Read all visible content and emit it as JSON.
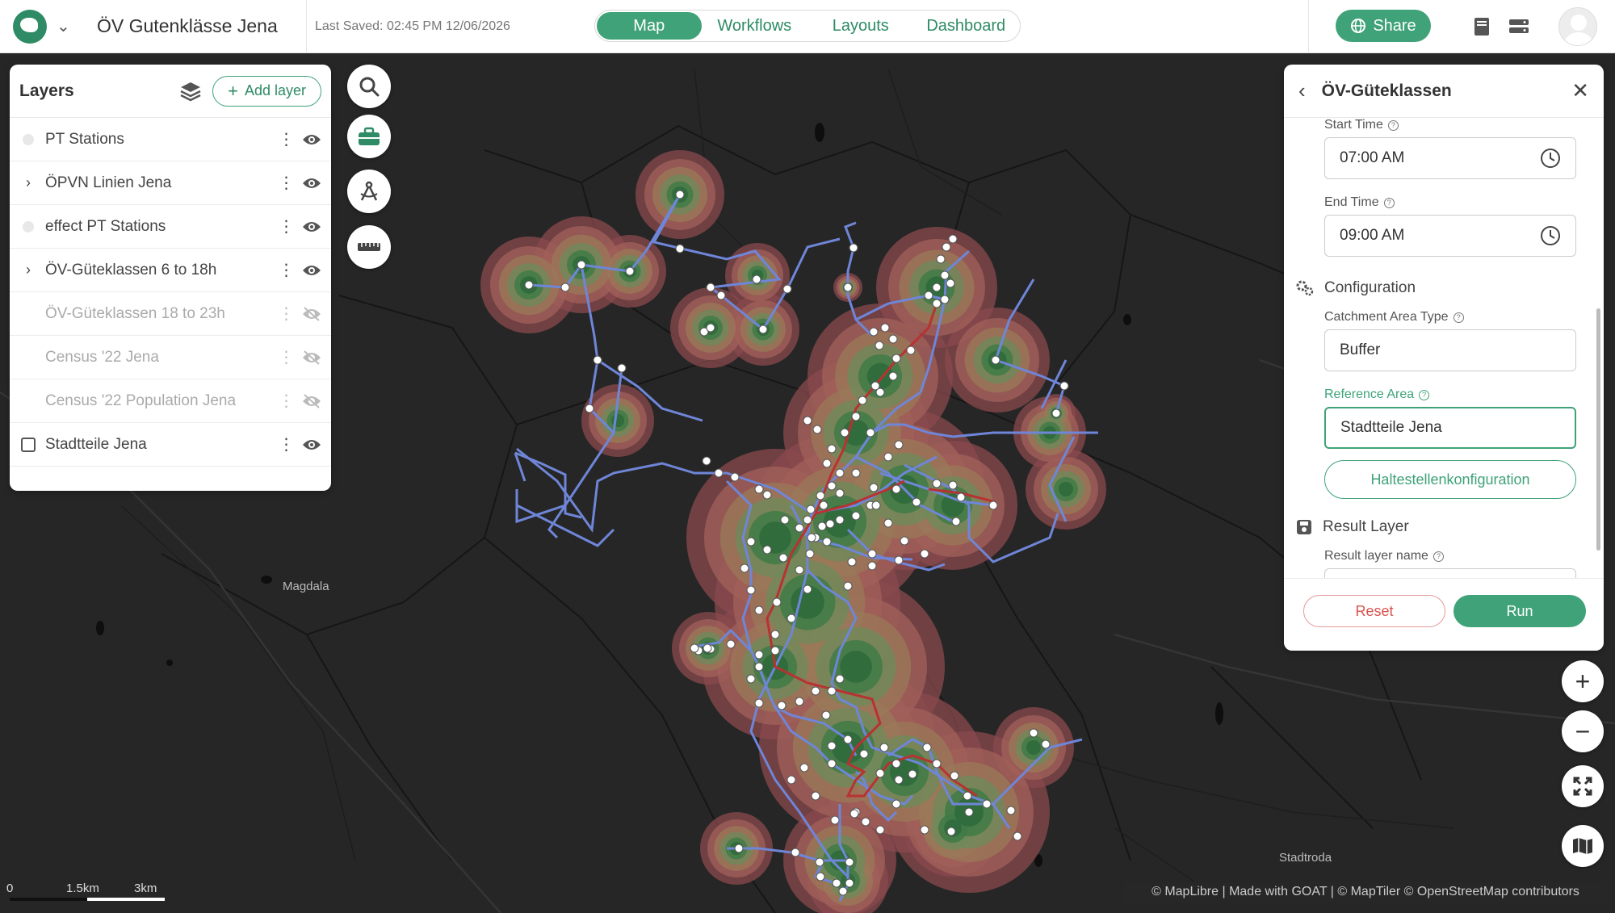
{
  "header": {
    "project_name": "ÖV Gutenklässe Jena",
    "last_saved": "Last Saved: 02:45 PM 12/06/2026",
    "tabs": [
      {
        "label": "Map",
        "active": true
      },
      {
        "label": "Workflows",
        "active": false
      },
      {
        "label": "Layouts",
        "active": false
      },
      {
        "label": "Dashboard",
        "active": false
      }
    ],
    "share_label": "Share",
    "accent_color": "#3fa278"
  },
  "layers_panel": {
    "title": "Layers",
    "add_layer_label": "Add layer",
    "layers": [
      {
        "name": "PT Stations",
        "lead": "dot",
        "visible": true
      },
      {
        "name": "ÖPVN Linien Jena",
        "lead": "chevron",
        "visible": true
      },
      {
        "name": "effect PT Stations",
        "lead": "dot",
        "visible": true
      },
      {
        "name": "ÖV-Güteklassen 6 to 18h",
        "lead": "chevron",
        "visible": true
      },
      {
        "name": "ÖV-Güteklassen 18 to 23h",
        "lead": "none",
        "visible": false
      },
      {
        "name": "Census '22 Jena",
        "lead": "none",
        "visible": false
      },
      {
        "name": "Census '22 Population Jena",
        "lead": "none",
        "visible": false
      },
      {
        "name": "Stadtteile Jena",
        "lead": "checkbox",
        "visible": true
      }
    ]
  },
  "map_tools": [
    "search-icon",
    "toolbox-icon",
    "compass-icon",
    "ruler-icon"
  ],
  "tool_panel": {
    "title": "ÖV-Güteklassen",
    "start_time_label": "Start Time",
    "start_time_value": "07:00 AM",
    "end_time_label": "End Time",
    "end_time_value": "09:00 AM",
    "configuration_label": "Configuration",
    "catchment_label": "Catchment Area Type",
    "catchment_value": "Buffer",
    "reference_area_label": "Reference Area",
    "reference_area_value": "Stadtteile Jena",
    "stop_config_label": "Haltestellenkonfiguration",
    "result_layer_label": "Result Layer",
    "result_layer_name_label": "Result layer name",
    "reset_label": "Reset",
    "run_label": "Run"
  },
  "map": {
    "places": [
      {
        "name": "Magdala"
      },
      {
        "name": "Stadtroda"
      }
    ],
    "scale_labels": [
      "0",
      "1.5km",
      "3km"
    ],
    "attribution": "© MapLibre | Made with GOAT | © MapTiler © OpenStreetMap contributors"
  }
}
